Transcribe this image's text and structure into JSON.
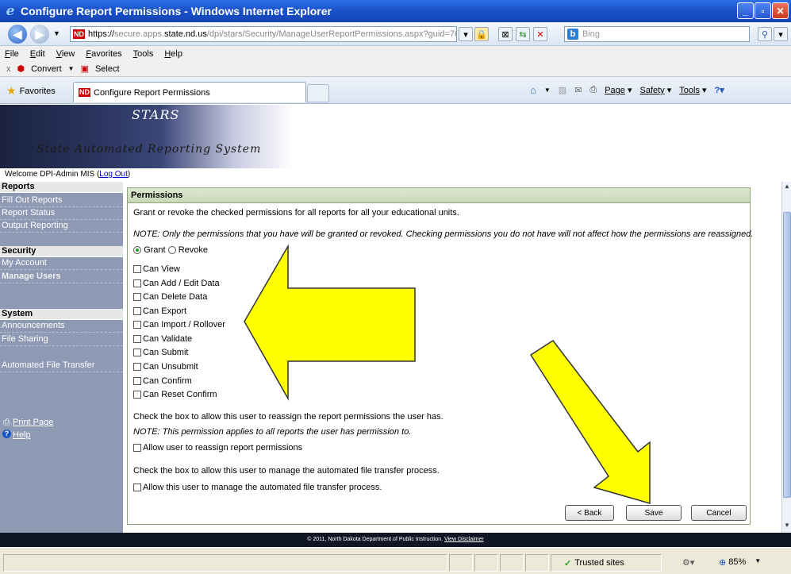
{
  "window": {
    "title": "Configure Report Permissions - Windows Internet Explorer"
  },
  "address": {
    "url_prefix": "https://",
    "url_host_pre": "secure.apps.",
    "url_host_bold": "state.nd.us",
    "url_path": "/dpi/stars/Security/ManageUserReportPermissions.aspx?guid=7641",
    "search_placeholder": "Bing"
  },
  "menu": {
    "items": [
      "File",
      "Edit",
      "View",
      "Favorites",
      "Tools",
      "Help"
    ]
  },
  "toolbar2": {
    "close": "x",
    "convert": "Convert",
    "select": "Select"
  },
  "favorites": {
    "label": "Favorites",
    "tab_title": "Configure Report Permissions",
    "cmd": {
      "page": "Page",
      "safety": "Safety",
      "tools": "Tools"
    }
  },
  "banner": {
    "title": "STARS",
    "subtitle": "State Automated Reporting System"
  },
  "welcome": {
    "text": "Welcome DPI-Admin MIS (",
    "logout": "Log Out",
    "close": ")"
  },
  "nav": {
    "reports_head": "Reports",
    "reports": [
      "Fill Out Reports",
      "Report Status",
      "Output Reporting"
    ],
    "security_head": "Security",
    "security": [
      "My Account",
      "Manage Users"
    ],
    "system_head": "System",
    "system": [
      "Announcements",
      "File Sharing"
    ],
    "aft": "Automated File Transfer",
    "print": "Print Page",
    "help": "Help"
  },
  "panel": {
    "title": "Permissions",
    "intro": "Grant or revoke the checked permissions for all reports for all your educational units.",
    "note": "NOTE: Only the permissions that you have will be granted or revoked. Checking permissions you do not have will not affect how the permissions are reassigned.",
    "grant": "Grant",
    "revoke": "Revoke",
    "permissions": [
      "Can View",
      "Can Add / Edit Data",
      "Can Delete Data",
      "Can Export",
      "Can Import / Rollover",
      "Can Validate",
      "Can Submit",
      "Can Unsubmit",
      "Can Confirm",
      "Can Reset Confirm"
    ],
    "reassign_text": "Check the box to allow this user to reassign the report permissions the user has.",
    "reassign_note": "NOTE: This permission applies to all reports the user has permission to.",
    "reassign_cb": "Allow user to reassign report permissions",
    "aft_text": "Check the box to allow this user to manage the automated file transfer process.",
    "aft_cb": "Allow this user to manage the automated file transfer process.",
    "back": "< Back",
    "save": "Save",
    "cancel": "Cancel"
  },
  "footer": {
    "text": "© 2011, North Dakota Department of Public Instruction.",
    "link": "View Disclaimer"
  },
  "status": {
    "zone": "Trusted sites",
    "zoom": "85%"
  },
  "colors": {
    "annotation_arrow": "#ffff00",
    "nav_bg": "#8e9ab3",
    "panel_header": "#c9d8b6"
  }
}
